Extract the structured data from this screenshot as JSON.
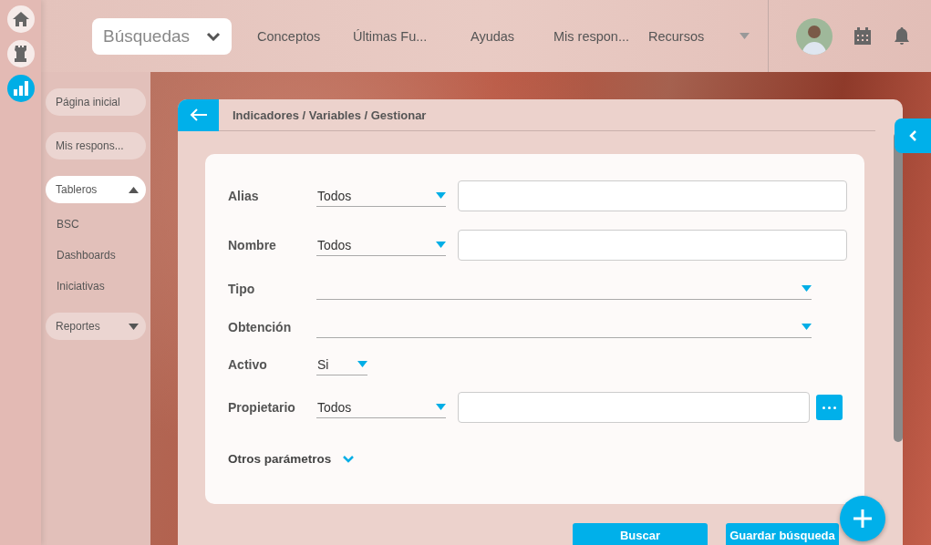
{
  "nav_rail": [
    {
      "kind": "home",
      "selected": false
    },
    {
      "kind": "rook",
      "selected": false
    },
    {
      "kind": "chart",
      "selected": true
    }
  ],
  "top_bar": {
    "search_dropdown": "Búsquedas",
    "links": [
      "Conceptos",
      "Últimas Fu...",
      "Ayudas",
      "Mis respon...",
      "Recursos"
    ]
  },
  "sidebar": {
    "items": [
      {
        "kind": "button",
        "label": "Página inicial"
      },
      {
        "kind": "button",
        "label": "Mis respons..."
      },
      {
        "kind": "group",
        "label": "Tableros",
        "expanded": true,
        "children": [
          {
            "label": "BSC"
          },
          {
            "label": "Dashboards"
          },
          {
            "label": "Iniciativas"
          }
        ]
      },
      {
        "kind": "group",
        "label": "Reportes",
        "expanded": false
      }
    ]
  },
  "panel": {
    "breadcrumb": "Indicadores / Variables / Gestionar",
    "fields": [
      {
        "kind": "text",
        "label": "Alias",
        "operator": "Todos"
      },
      {
        "kind": "text",
        "label": "Nombre",
        "operator": "Todos"
      },
      {
        "kind": "select",
        "label": "Tipo"
      },
      {
        "kind": "select",
        "label": "Obtención"
      },
      {
        "kind": "short",
        "label": "Activo",
        "value": "Si"
      },
      {
        "kind": "lookup",
        "label": "Propietario",
        "operator": "Todos"
      }
    ],
    "more_options": {
      "label": "Otros parámetros",
      "expanded": false
    },
    "buttons": [
      "Buscar",
      "Guardar búsqueda"
    ]
  }
}
